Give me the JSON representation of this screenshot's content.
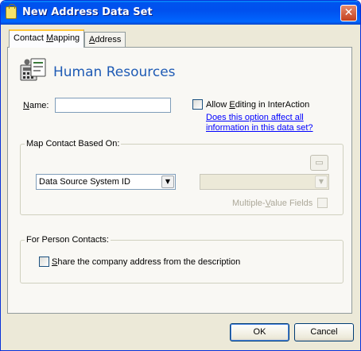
{
  "window": {
    "title": "New Address Data Set",
    "close_glyph": "✕"
  },
  "tabs": [
    {
      "label": "Contact Mapping",
      "mnemonic_prefix": "Contact ",
      "mnemonic": "M",
      "suffix": "apping",
      "active": true
    },
    {
      "label": "Address",
      "mnemonic_prefix": "",
      "mnemonic": "A",
      "suffix": "ddress",
      "active": false
    }
  ],
  "header": {
    "title": "Human Resources",
    "icon": "contacts-phone-icon"
  },
  "name_field": {
    "label_mn": "N",
    "label_rest": "ame:",
    "value": ""
  },
  "allow_editing": {
    "pre": "Allow ",
    "mn": "E",
    "post": "diting in InterAction",
    "checked": false
  },
  "help_link": {
    "line1": "Does this option affect all",
    "line2": "information in this data set?"
  },
  "map_group": {
    "legend": "Map Contact Based On:",
    "primary_select": "Data Source System ID",
    "secondary_select": "",
    "folder_icon": "folder-icon",
    "multi_pre": "Multiple-",
    "multi_mn": "V",
    "multi_post": "alue Fields",
    "multi_checked": false
  },
  "person_group": {
    "legend": "For Person Contacts:",
    "share_mn": "S",
    "share_post": "hare the company address from the description",
    "share_checked": false
  },
  "buttons": {
    "ok": "OK",
    "cancel": "Cancel"
  },
  "colors": {
    "accent_title": "#1f5bb5",
    "titlebar": "#0054e3",
    "link": "#0000ff",
    "face": "#ece9d8"
  }
}
